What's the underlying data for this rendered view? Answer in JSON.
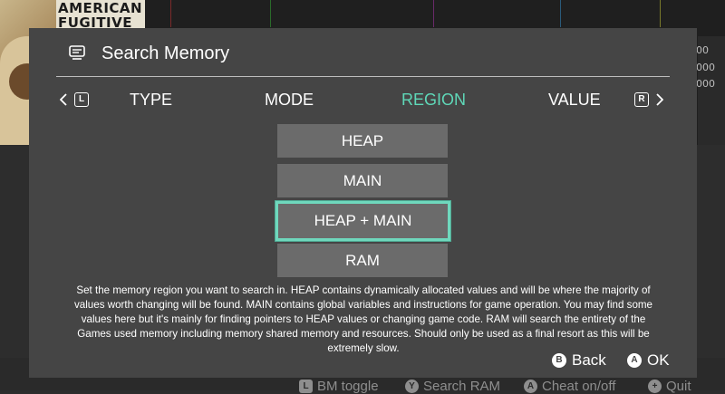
{
  "background": {
    "game_art_title": "AMERICAN FUGITIVE",
    "right_values": [
      "00",
      "000",
      "000"
    ],
    "footer_hints": [
      {
        "icon": "L",
        "label": "BM toggle"
      },
      {
        "icon": "Y",
        "label": "Search RAM"
      },
      {
        "icon": "A",
        "label": "Cheat on/off"
      },
      {
        "icon": "+",
        "label": "Quit"
      }
    ]
  },
  "dialog": {
    "title": "Search Memory",
    "icon": "memory-card-icon",
    "tabs": [
      {
        "label": "TYPE",
        "active": false
      },
      {
        "label": "MODE",
        "active": false
      },
      {
        "label": "REGION",
        "active": true
      },
      {
        "label": "VALUE",
        "active": false
      }
    ],
    "nav_left_button": "L",
    "nav_right_button": "R",
    "options": [
      {
        "label": "HEAP",
        "selected": false
      },
      {
        "label": "MAIN",
        "selected": false
      },
      {
        "label": "HEAP + MAIN",
        "selected": true
      },
      {
        "label": "RAM",
        "selected": false
      }
    ],
    "description": "Set the memory region you want to search in. HEAP contains dynamically allocated values and will be where the majority of values worth changing will be found. MAIN contains global variables and instructions for game operation. You may find some values here but it's mainly for finding pointers to HEAP values or changing game code. RAM will search the entirety of the Games used memory including memory shared memory and resources. Should only be used as a final resort as this will be extremely slow.",
    "actions": {
      "back": {
        "button": "B",
        "label": "Back"
      },
      "ok": {
        "button": "A",
        "label": "OK"
      }
    }
  },
  "colors": {
    "accent": "#5fd8b8",
    "dialog_bg": "#454545",
    "option_bg": "#6b6b6b"
  }
}
